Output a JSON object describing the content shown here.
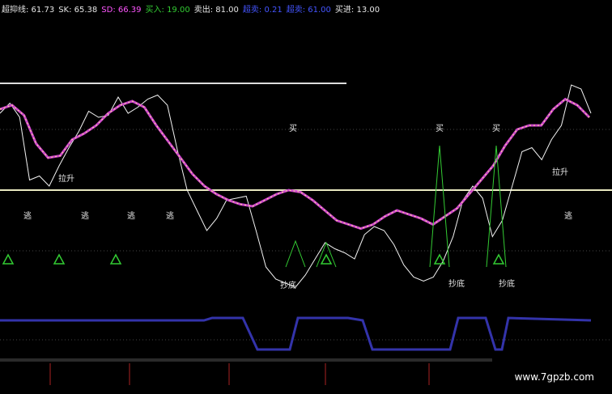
{
  "legend": [
    {
      "label": "超抑线: 61.73",
      "color": "#e6e6e6"
    },
    {
      "label": "SK: 65.38",
      "color": "#e6e6e6"
    },
    {
      "label": "SD: 66.39",
      "color": "#ff55ff"
    },
    {
      "label": "买入: 19.00",
      "color": "#33cc33"
    },
    {
      "label": "卖出: 81.00",
      "color": "#e6e6e6"
    },
    {
      "label": "超卖: 0.21",
      "color": "#4455ff"
    },
    {
      "label": "超卖: 61.00",
      "color": "#4455ff"
    },
    {
      "label": "买进: 13.00",
      "color": "#e6e6e6"
    }
  ],
  "watermark": "www.7gpzb.com",
  "colors": {
    "background": "#000000",
    "sk": "#f2f2f2",
    "sd": "#cc44cc",
    "sd_highlight": "#ffee88",
    "line50": "#e8e8c0",
    "buy_signal": "#33cc33",
    "overbought_band": "#3333aa",
    "grid": "#444444",
    "tick": "#aa2222"
  },
  "chart_data": {
    "type": "line",
    "title": "",
    "xlabel": "",
    "ylabel": "",
    "ylim": [
      0,
      120
    ],
    "grid": true,
    "series": [
      {
        "values": [
          88,
          93,
          86,
          55,
          57,
          52,
          62,
          71,
          79,
          89,
          86,
          87,
          96,
          88,
          91,
          95,
          97,
          92,
          70,
          50,
          40,
          30,
          36,
          45,
          46,
          47,
          30,
          12,
          6,
          4,
          2,
          8,
          16,
          24,
          21,
          19,
          16,
          28,
          32,
          30,
          23,
          13,
          7,
          5,
          7,
          15,
          27,
          45,
          52,
          46,
          27,
          35,
          52,
          69,
          71,
          65,
          75,
          82,
          102,
          100,
          88
        ]
      },
      {
        "values": [
          90,
          92,
          87,
          73,
          66,
          67,
          75,
          78,
          82,
          88,
          92,
          94,
          91,
          82,
          74,
          66,
          58,
          52,
          48,
          45,
          43,
          42,
          45,
          48,
          50,
          49,
          45,
          40,
          35,
          33,
          31,
          33,
          37,
          40,
          38,
          36,
          33,
          37,
          41,
          48,
          55,
          62,
          72,
          80,
          82,
          82,
          90,
          95,
          92,
          86
        ]
      },
      {
        "values": [
          50,
          50,
          50,
          50,
          50,
          50,
          50,
          50,
          50,
          50,
          50,
          50,
          50,
          50,
          50,
          50,
          50,
          50,
          50,
          50,
          50,
          50,
          50,
          50,
          50,
          50,
          50,
          50,
          50,
          50,
          50,
          50,
          50,
          50,
          50,
          50,
          50,
          50,
          50,
          50,
          50,
          50,
          50,
          50,
          50,
          50,
          50,
          50,
          50,
          50
        ]
      }
    ],
    "annotations": [
      {
        "text": "买",
        "color": "#e6e6e6"
      },
      {
        "text": "买",
        "color": "#e6e6e6"
      },
      {
        "text": "买",
        "color": "#e6e6e6"
      },
      {
        "text": "拉升",
        "color": "#e6e6e6"
      },
      {
        "text": "拉升",
        "color": "#e6e6e6"
      },
      {
        "text": "逃",
        "color": "#e6e6e6"
      },
      {
        "text": "逃",
        "color": "#e6e6e6"
      },
      {
        "text": "逃",
        "color": "#e6e6e6"
      },
      {
        "text": "逃",
        "color": "#e6e6e6"
      },
      {
        "text": "逃",
        "color": "#e6e6e6"
      },
      {
        "text": "抄底",
        "color": "#e6e6e6"
      },
      {
        "text": "抄底",
        "color": "#e6e6e6"
      },
      {
        "text": "抄底",
        "color": "#e6e6e6"
      }
    ]
  }
}
